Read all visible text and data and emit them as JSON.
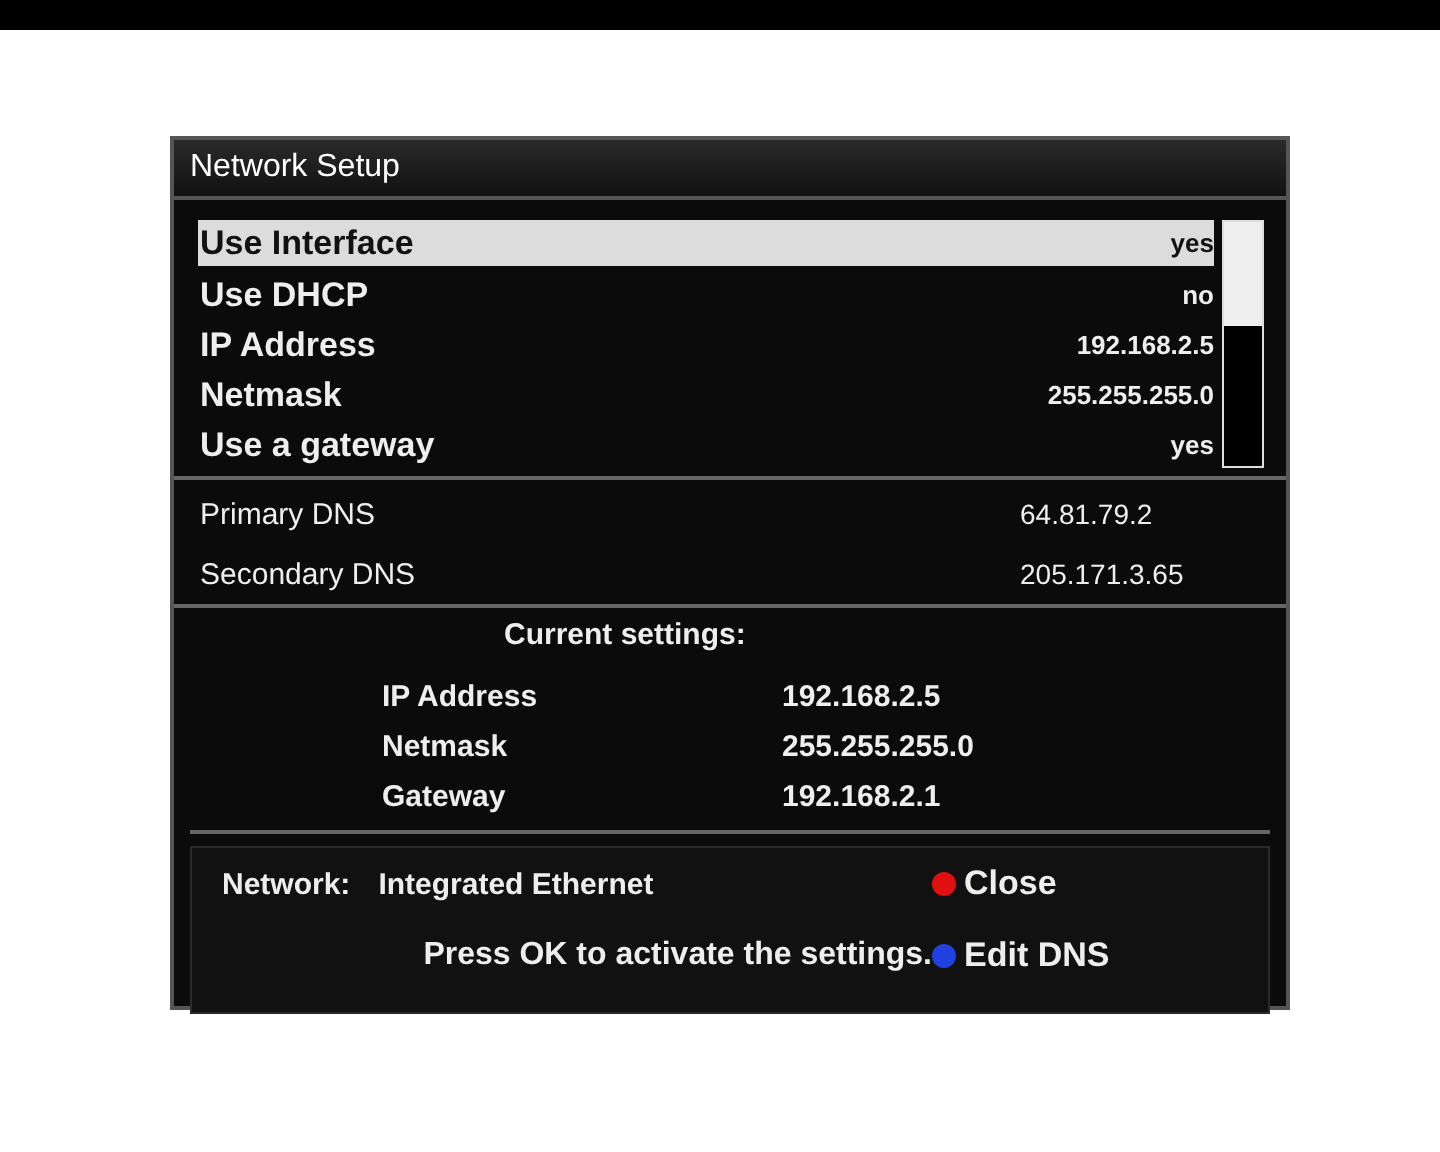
{
  "window": {
    "title": "Network Setup"
  },
  "menu": [
    {
      "label": "Use Interface",
      "value": "yes",
      "selected": true
    },
    {
      "label": "Use DHCP",
      "value": "no",
      "selected": false
    },
    {
      "label": "IP Address",
      "value": "192.168.2.5",
      "selected": false
    },
    {
      "label": "Netmask",
      "value": "255.255.255.0",
      "selected": false
    },
    {
      "label": "Use a gateway",
      "value": "yes",
      "selected": false
    }
  ],
  "dns": [
    {
      "label": "Primary DNS",
      "value": "64.81.79.2"
    },
    {
      "label": "Secondary DNS",
      "value": "205.171.3.65"
    }
  ],
  "current_settings": {
    "title": "Current settings:",
    "rows": [
      {
        "label": "IP Address",
        "value": "192.168.2.5"
      },
      {
        "label": "Netmask",
        "value": "255.255.255.0"
      },
      {
        "label": "Gateway",
        "value": "192.168.2.1"
      }
    ]
  },
  "footer": {
    "network_label": "Network:",
    "network_value": "Integrated Ethernet",
    "hint": "Press OK to activate the settings.",
    "buttons": [
      {
        "label": "Close",
        "color": "#e01010"
      },
      {
        "label": "Edit DNS",
        "color": "#2040e0"
      }
    ]
  }
}
